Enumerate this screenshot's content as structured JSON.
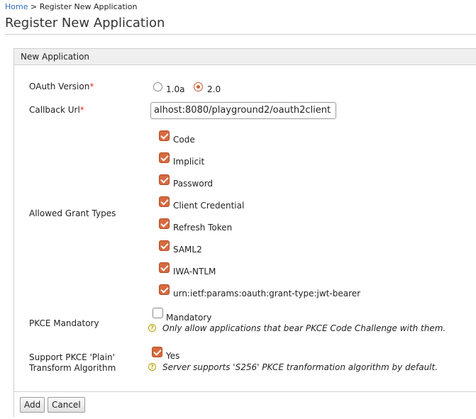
{
  "breadcrumb": {
    "home": "Home",
    "separator": " > ",
    "current": "Register New Application"
  },
  "page_title": "Register New Application",
  "form": {
    "section_title": "New Application",
    "oauth_version": {
      "label": "OAuth Version",
      "required_mark": "*",
      "options": [
        {
          "label": "1.0a",
          "selected": false
        },
        {
          "label": "2.0",
          "selected": true
        }
      ]
    },
    "callback_url": {
      "label": "Callback Url",
      "required_mark": "*",
      "value": "alhost:8080/playground2/oauth2client"
    },
    "grant_types": {
      "label": "Allowed Grant Types",
      "options": [
        {
          "label": "Code",
          "checked": true
        },
        {
          "label": "Implicit",
          "checked": true
        },
        {
          "label": "Password",
          "checked": true
        },
        {
          "label": "Client Credential",
          "checked": true
        },
        {
          "label": "Refresh Token",
          "checked": true
        },
        {
          "label": "SAML2",
          "checked": true
        },
        {
          "label": "IWA-NTLM",
          "checked": true
        },
        {
          "label": "urn:ietf:params:oauth:grant-type:jwt-bearer",
          "checked": true
        }
      ]
    },
    "pkce_mandatory": {
      "label": "PKCE Mandatory",
      "option_label": "Mandatory",
      "checked": false,
      "help_icon": "?",
      "help": "Only allow applications that bear PKCE Code Challenge with them."
    },
    "pkce_plain": {
      "label_line1": "Support PKCE 'Plain'",
      "label_line2": "Transform Algorithm",
      "option_label": "Yes",
      "checked": true,
      "help_icon": "?",
      "help": "Server supports 'S256' PKCE tranformation algorithm by default."
    },
    "buttons": {
      "add": "Add",
      "cancel": "Cancel"
    }
  },
  "colors": {
    "accent": "#d8693e",
    "link": "#2a6ebb",
    "required": "#d9362b"
  }
}
